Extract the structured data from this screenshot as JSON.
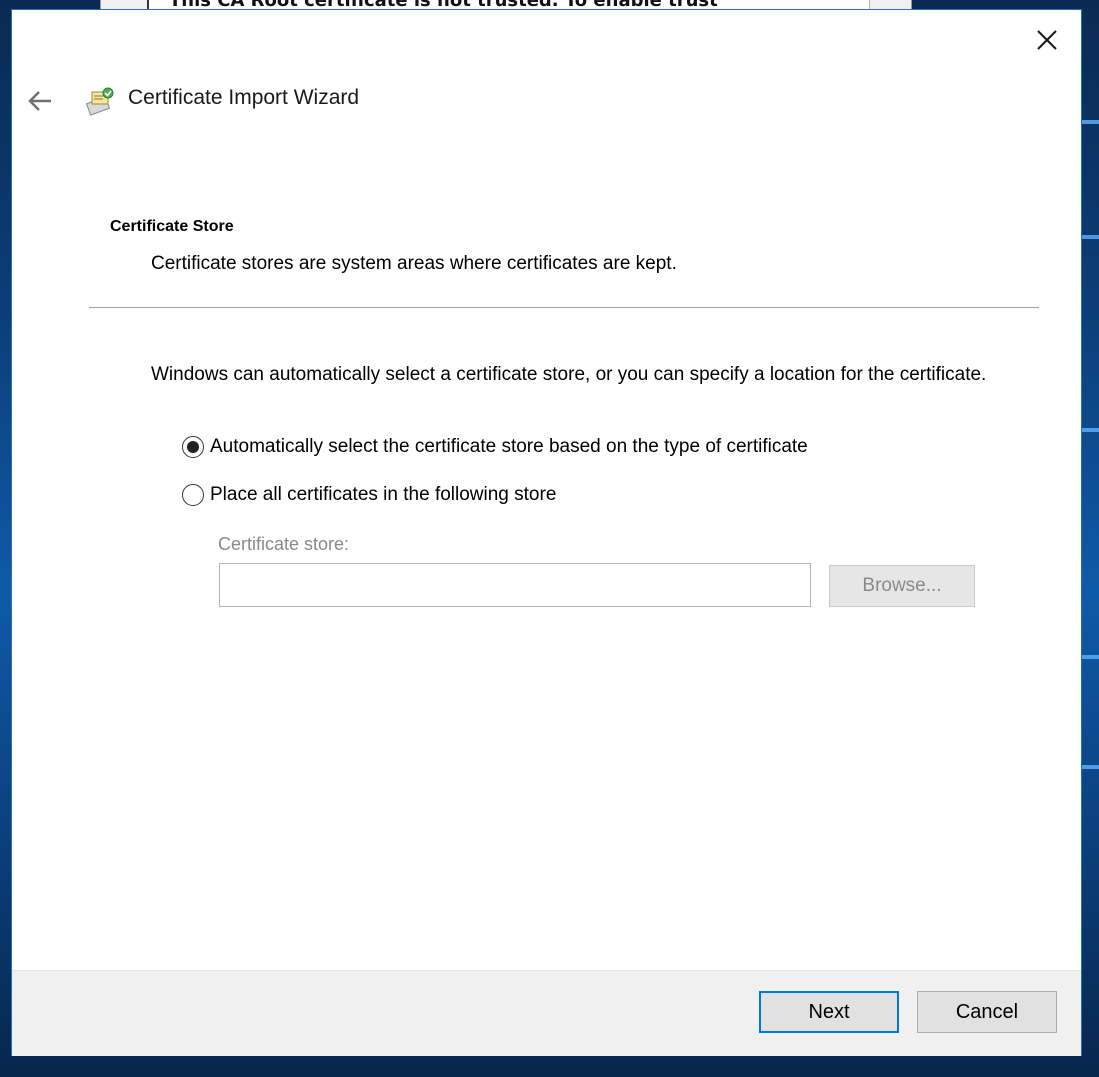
{
  "background_window": {
    "partial_title": "This CA Root certificate is not trusted. To enable trust"
  },
  "dialog": {
    "title": "Certificate Import Wizard",
    "icons": {
      "close": "close-icon",
      "back": "back-arrow-icon",
      "wizard": "certificate-wizard-icon"
    },
    "section": {
      "title": "Certificate Store",
      "description": "Certificate stores are system areas where certificates are kept."
    },
    "intro": "Windows can automatically select a certificate store, or you can specify a location for the certificate.",
    "options": [
      {
        "label": "Automatically select the certificate store based on the type of certificate",
        "selected": true
      },
      {
        "label": "Place all certificates in the following store",
        "selected": false
      }
    ],
    "store": {
      "label": "Certificate store:",
      "value": "",
      "browse_label": "Browse...",
      "enabled": false
    },
    "buttons": {
      "next": "Next",
      "cancel": "Cancel"
    }
  },
  "colors": {
    "accent": "#0078d7",
    "disabled_text": "#8a8a8a",
    "footer_bg": "#f0f0f0"
  }
}
